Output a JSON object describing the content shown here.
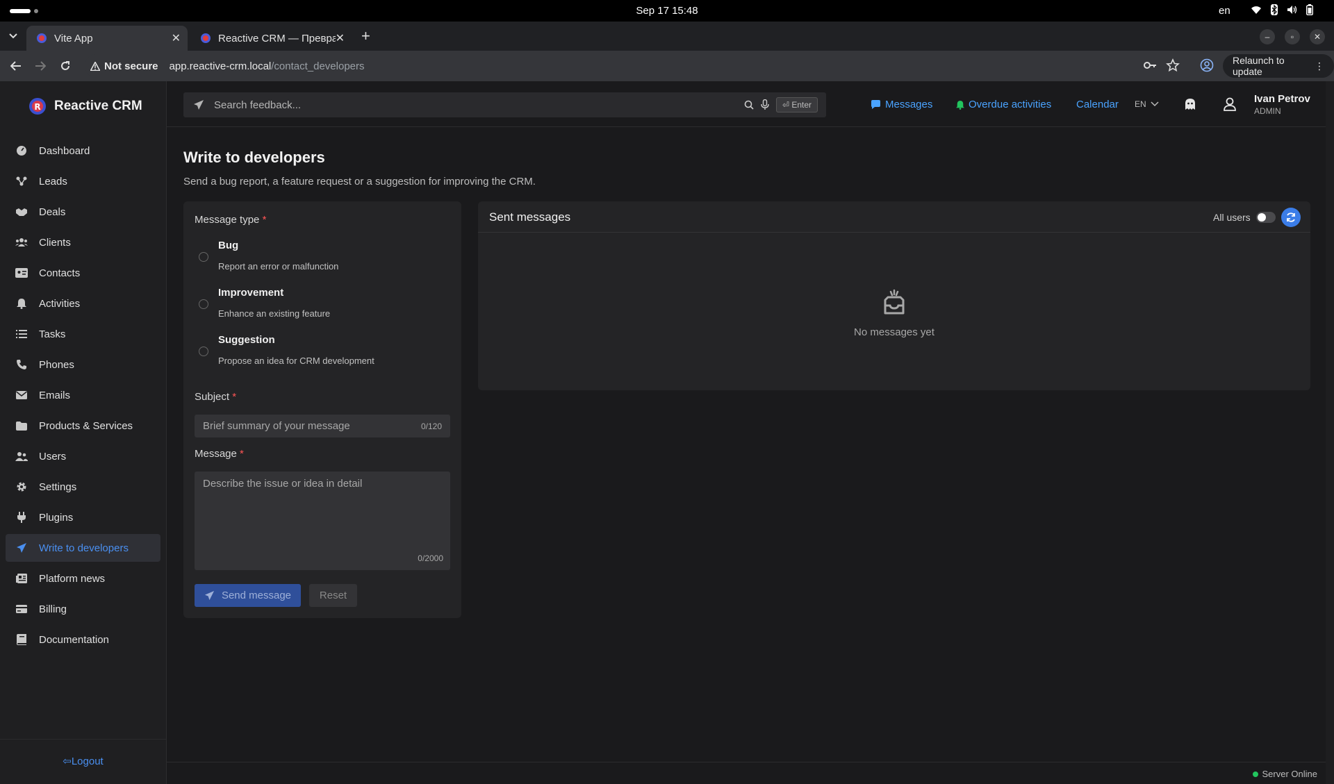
{
  "os": {
    "clock": "Sep 17  15:48",
    "lang": "en"
  },
  "browser": {
    "tabs": [
      {
        "title": "Vite App",
        "active": true
      },
      {
        "title": "Reactive CRM — Превра",
        "active": false
      }
    ],
    "security": "Not secure",
    "url_host": "app.reactive-crm.local",
    "url_path": "/contact_developers",
    "relaunch": "Relaunch to update"
  },
  "brand": {
    "name": "Reactive CRM"
  },
  "sidebar": {
    "items": [
      {
        "label": "Dashboard",
        "icon": "dashboard-icon"
      },
      {
        "label": "Leads",
        "icon": "leads-icon"
      },
      {
        "label": "Deals",
        "icon": "handshake-icon"
      },
      {
        "label": "Clients",
        "icon": "users-group-icon"
      },
      {
        "label": "Contacts",
        "icon": "id-card-icon"
      },
      {
        "label": "Activities",
        "icon": "bell-icon"
      },
      {
        "label": "Tasks",
        "icon": "list-icon"
      },
      {
        "label": "Phones",
        "icon": "phone-icon"
      },
      {
        "label": "Emails",
        "icon": "envelope-icon"
      },
      {
        "label": "Products & Services",
        "icon": "folder-icon"
      },
      {
        "label": "Users",
        "icon": "user-group-icon"
      },
      {
        "label": "Settings",
        "icon": "gear-icon"
      },
      {
        "label": "Plugins",
        "icon": "plug-icon"
      },
      {
        "label": "Write to developers",
        "icon": "paper-plane-icon",
        "active": true
      },
      {
        "label": "Platform news",
        "icon": "newspaper-icon"
      },
      {
        "label": "Billing",
        "icon": "credit-card-icon"
      },
      {
        "label": "Documentation",
        "icon": "book-icon"
      }
    ],
    "logout": "Logout"
  },
  "header": {
    "search_placeholder": "Search feedback...",
    "enter_label": "Enter",
    "messages": "Messages",
    "overdue": "Overdue activities",
    "calendar": "Calendar",
    "lang": "EN",
    "user_name": "Ivan Petrov",
    "user_role": "ADMIN"
  },
  "page": {
    "title": "Write to developers",
    "subtitle": "Send a bug report, a feature request or a suggestion for improving the CRM."
  },
  "form": {
    "type_label": "Message type",
    "required_mark": "*",
    "types": [
      {
        "title": "Bug",
        "desc": "Report an error or malfunction"
      },
      {
        "title": "Improvement",
        "desc": "Enhance an existing feature"
      },
      {
        "title": "Suggestion",
        "desc": "Propose an idea for CRM development"
      }
    ],
    "subject_label": "Subject",
    "subject_placeholder": "Brief summary of your message",
    "subject_counter": "0/120",
    "message_label": "Message",
    "message_placeholder": "Describe the issue or idea in detail",
    "message_counter": "0/2000",
    "send": "Send message",
    "reset": "Reset"
  },
  "messages": {
    "title": "Sent messages",
    "all_users": "All users",
    "all_users_on": false,
    "empty": "No messages yet"
  },
  "status": {
    "server": "Server Online"
  },
  "colors": {
    "accent": "#4a8ff0",
    "link": "#4aa3ff",
    "online": "#22c55e",
    "required": "#ff5555"
  }
}
